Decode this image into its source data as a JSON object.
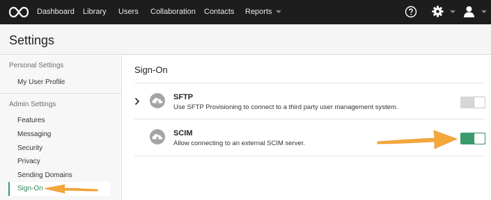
{
  "nav": {
    "items": [
      "Dashboard",
      "Library",
      "Users",
      "Collaboration",
      "Contacts",
      "Reports"
    ]
  },
  "header": {
    "title": "Settings"
  },
  "sidebar": {
    "personal_title": "Personal Settings",
    "personal_items": [
      "My User Profile"
    ],
    "admin_title": "Admin Settings",
    "admin_items": [
      "Features",
      "Messaging",
      "Security",
      "Privacy",
      "Sending Domains"
    ],
    "active_item": "Sign-On"
  },
  "main": {
    "title": "Sign-On",
    "rows": [
      {
        "name": "SFTP",
        "description": "Use SFTP Provisioning to connect to a third party user management system.",
        "enabled": false
      },
      {
        "name": "SCIM",
        "description": "Allow connecting to an external SCIM server.",
        "enabled": true
      }
    ]
  },
  "colors": {
    "nav_bg": "#1d1d1d",
    "accent_green": "#3a9b6c",
    "annotation_orange": "#f4a83a"
  },
  "icons": [
    "logo-icon",
    "help-icon",
    "gear-icon",
    "user-icon",
    "chevron-right-icon",
    "cloud-icon",
    "pointer-arrow"
  ]
}
